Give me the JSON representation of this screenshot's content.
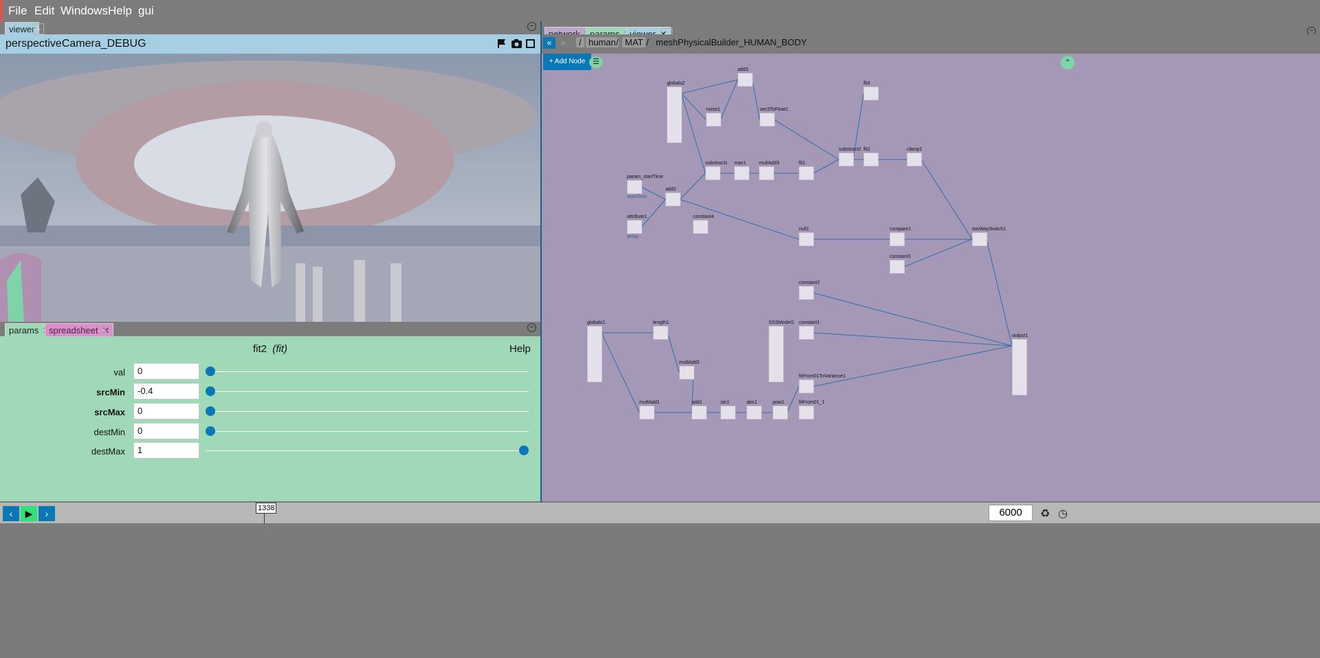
{
  "menu": [
    "File",
    "Edit",
    "Windows",
    "Help",
    "gui"
  ],
  "left_tabs": {
    "viewer": "viewer",
    "plus": "+"
  },
  "viewer": {
    "title": "perspectiveCamera_DEBUG"
  },
  "params_tabs": {
    "params": "params",
    "spreadsheet": "spreadsheet",
    "plus": "+"
  },
  "params": {
    "node_name": "fit2",
    "node_type": "(fit)",
    "help": "Help",
    "rows": [
      {
        "label": "val",
        "value": "0",
        "bold": false,
        "slider_fraction": 0.0
      },
      {
        "label": "srcMin",
        "value": "-0.4",
        "bold": true,
        "slider_fraction": 0.0
      },
      {
        "label": "srcMax",
        "value": "0",
        "bold": true,
        "slider_fraction": 0.0
      },
      {
        "label": "destMin",
        "value": "0",
        "bold": false,
        "slider_fraction": 0.0
      },
      {
        "label": "destMax",
        "value": "1",
        "bold": false,
        "slider_fraction": 1.0
      }
    ]
  },
  "right_tabs": {
    "network": "network",
    "params": "params",
    "viewer": "viewer",
    "plus": "+"
  },
  "breadcrumb": {
    "root": "/",
    "sep": "/",
    "human": "human",
    "mat": "MAT",
    "current": "meshPhysicalBuilder_HUMAN_BODY"
  },
  "network": {
    "add_node": "+ Add Node",
    "nodes": [
      "add3",
      "globals2",
      "fit3",
      "noise1",
      "vec3ToFloat1",
      "substract2",
      "fit2",
      "clamp1",
      "substract1",
      "max1",
      "multAdd3",
      "fit1",
      "param_startTime",
      "add2",
      "attribute1",
      "constant4",
      "null1",
      "compare1",
      "twoWaySwitch1",
      "constant3",
      "constant2",
      "globals1",
      "length1",
      "SSSModel1",
      "constant1",
      "output1",
      "multAdd2",
      "fitFrom01ToVariance1",
      "multAdd1",
      "add1",
      "sin1",
      "abs1",
      "pow1",
      "fitFrom01_1"
    ],
    "sublabels": {
      "startTime": "startTime",
      "delay": "delay"
    }
  },
  "timeline": {
    "current_frame": "1338",
    "end_frame": "6000"
  },
  "colors": {
    "viewer_header": "#a6cfe4",
    "params_bg": "#9fd9b7",
    "network_bg": "#a498b6",
    "accent": "#0b78b6",
    "play": "#2ee27a"
  }
}
